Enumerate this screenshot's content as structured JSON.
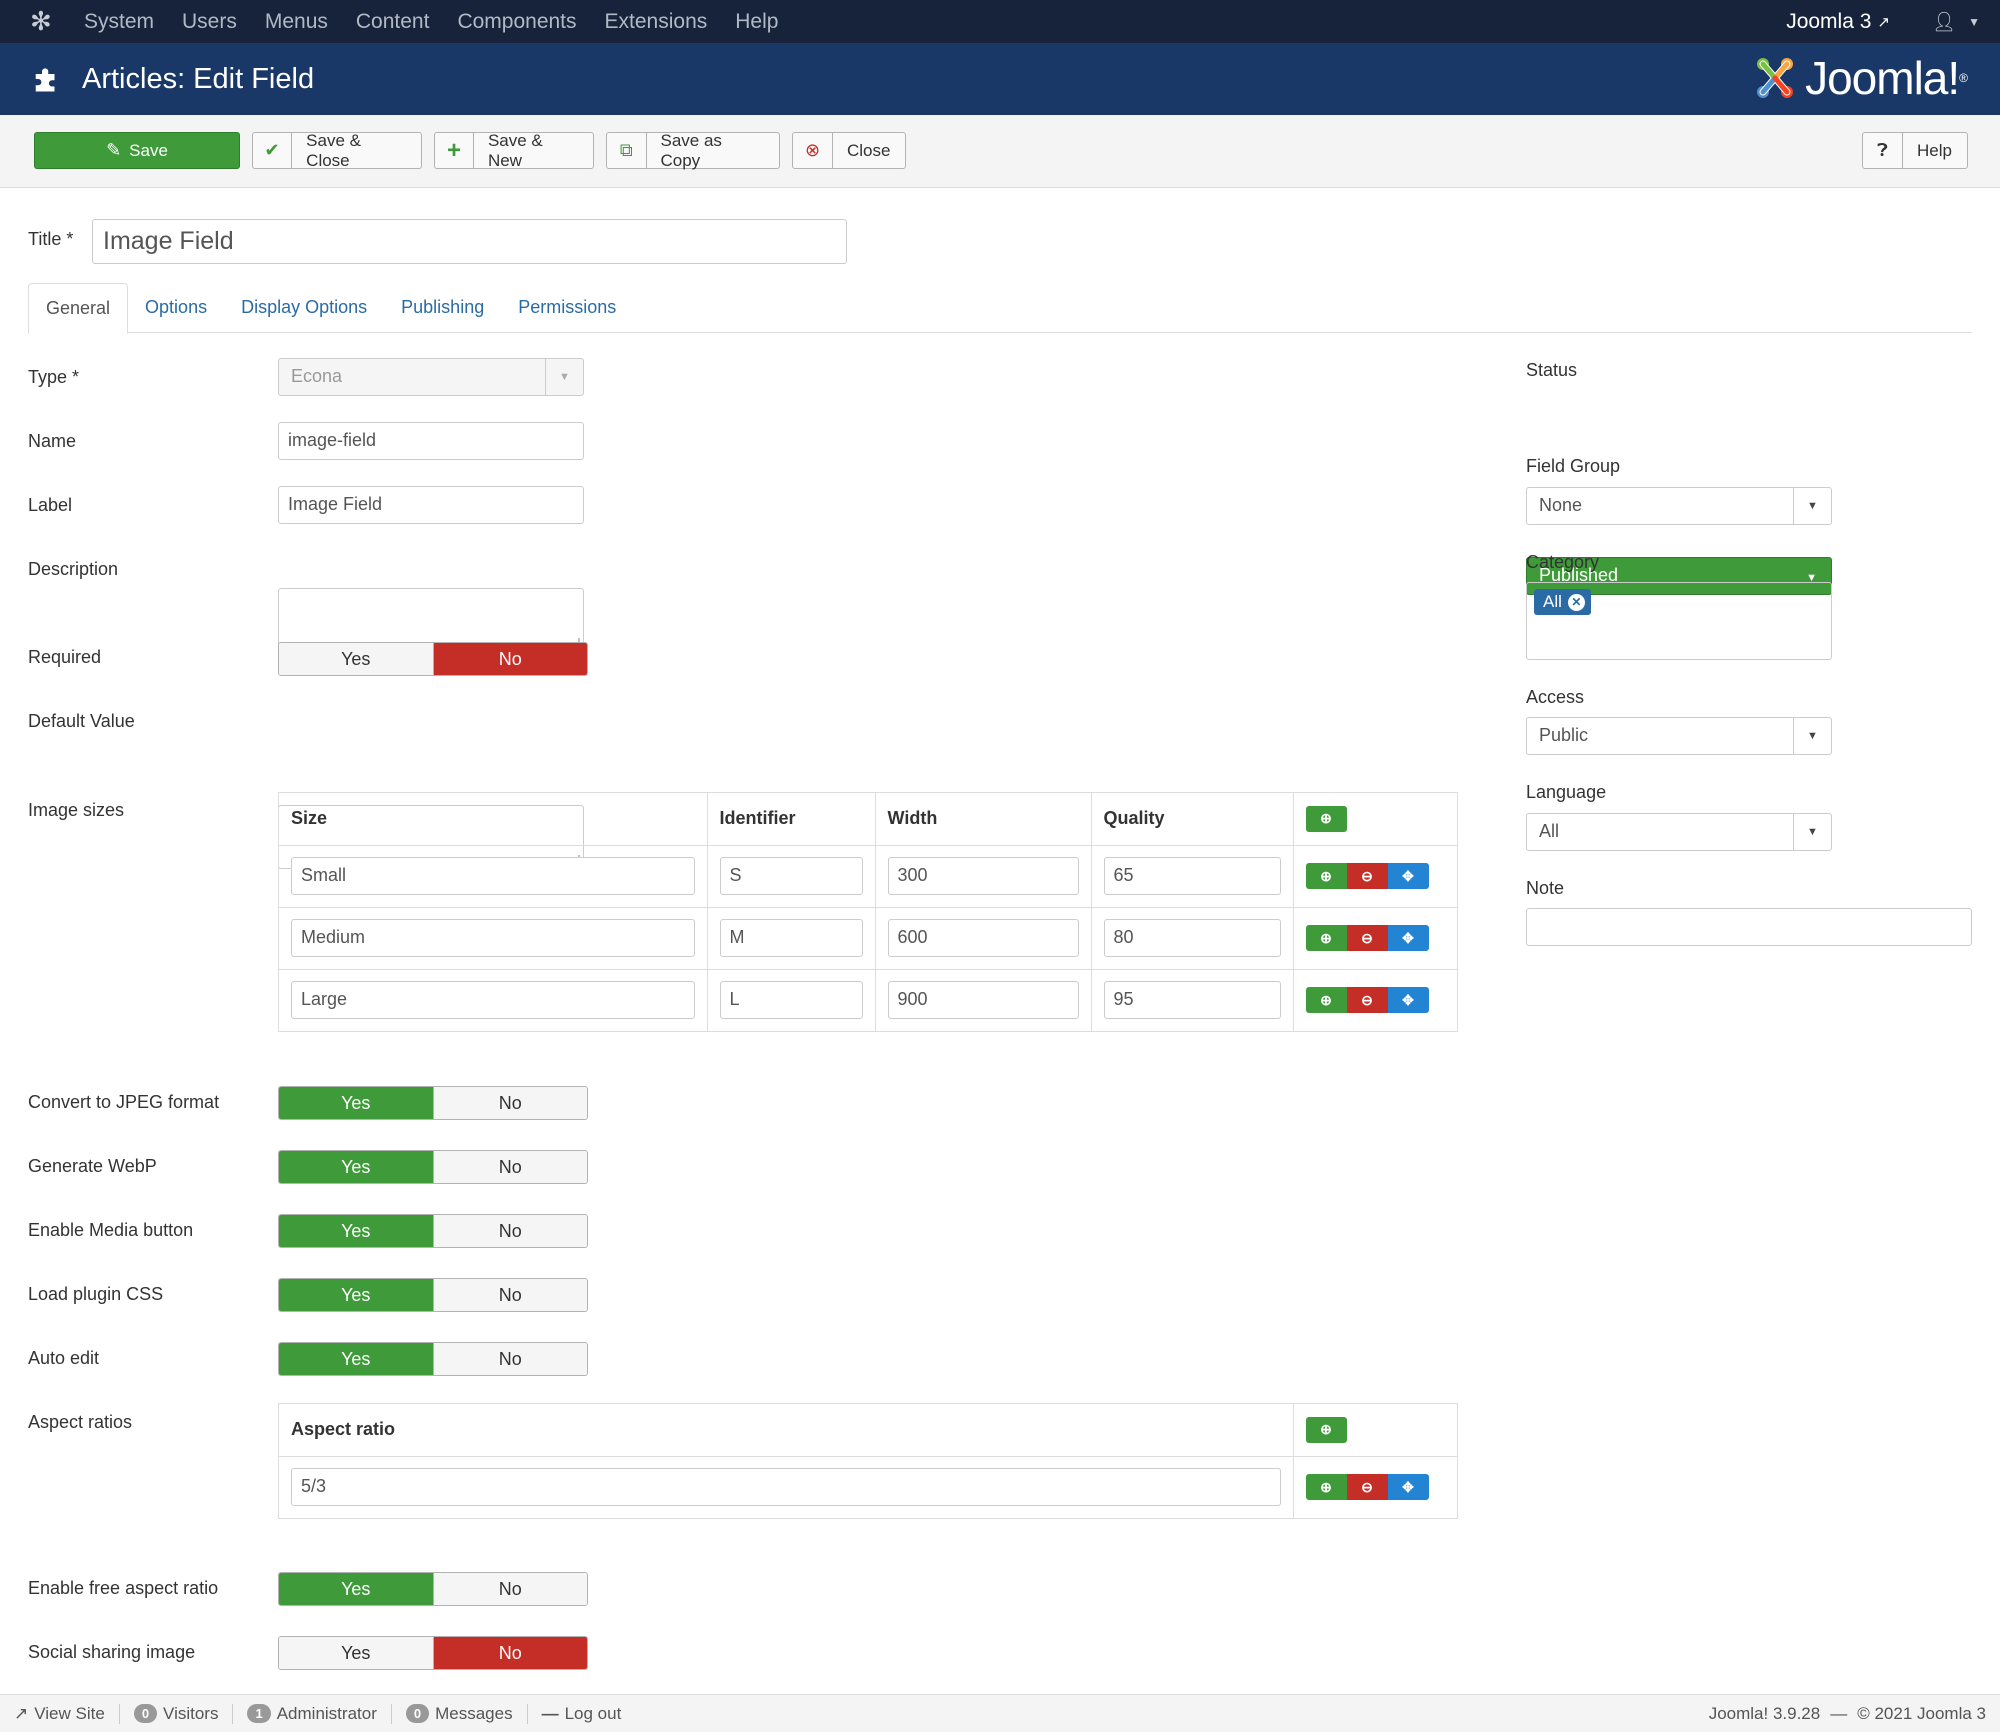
{
  "topnav": {
    "menu": [
      "System",
      "Users",
      "Menus",
      "Content",
      "Components",
      "Extensions",
      "Help"
    ],
    "site_name": "Joomla 3"
  },
  "header": {
    "title": "Articles: Edit Field",
    "brand": "Joomla!"
  },
  "toolbar": {
    "save": "Save",
    "save_close": "Save & Close",
    "save_new": "Save & New",
    "save_copy": "Save as Copy",
    "close": "Close",
    "help": "Help"
  },
  "form": {
    "title_label": "Title *",
    "title_value": "Image Field",
    "tabs": [
      "General",
      "Options",
      "Display Options",
      "Publishing",
      "Permissions"
    ],
    "type_label": "Type *",
    "type_value": "Econa",
    "name_label": "Name",
    "name_value": "image-field",
    "label_label": "Label",
    "label_value": "Image Field",
    "description_label": "Description",
    "required_label": "Required",
    "default_label": "Default Value",
    "image_sizes_label": "Image sizes",
    "yes": "Yes",
    "no": "No",
    "image_sizes": {
      "headers": [
        "Size",
        "Identifier",
        "Width",
        "Quality"
      ],
      "rows": [
        [
          "Small",
          "S",
          "300",
          "65"
        ],
        [
          "Medium",
          "M",
          "600",
          "80"
        ],
        [
          "Large",
          "L",
          "900",
          "95"
        ]
      ]
    },
    "convert_jpeg_label": "Convert to JPEG format",
    "webp_label": "Generate WebP",
    "media_button_label": "Enable Media button",
    "plugin_css_label": "Load plugin CSS",
    "auto_edit_label": "Auto edit",
    "aspect_ratios_label": "Aspect ratios",
    "aspect_ratios": {
      "header": "Aspect ratio",
      "rows": [
        "5/3"
      ]
    },
    "free_aspect_label": "Enable free aspect ratio",
    "social_label": "Social sharing image"
  },
  "sidebar": {
    "status_label": "Status",
    "status_value": "Published",
    "field_group_label": "Field Group",
    "field_group_value": "None",
    "category_label": "Category",
    "category_chip": "All",
    "access_label": "Access",
    "access_value": "Public",
    "language_label": "Language",
    "language_value": "All",
    "note_label": "Note"
  },
  "statusbar": {
    "view_site": "View Site",
    "visitors_count": "0",
    "visitors": "Visitors",
    "admin_count": "1",
    "admin": "Administrator",
    "messages_count": "0",
    "messages": "Messages",
    "logout": "Log out",
    "version": "Joomla! 3.9.28",
    "copyright": "© 2021 Joomla 3"
  },
  "colors": {
    "nav": "#17233a",
    "header": "#1a3867",
    "green": "#3f9b3a",
    "red": "#c52d27",
    "blue": "#2384d3",
    "link": "#2a6ba6"
  }
}
